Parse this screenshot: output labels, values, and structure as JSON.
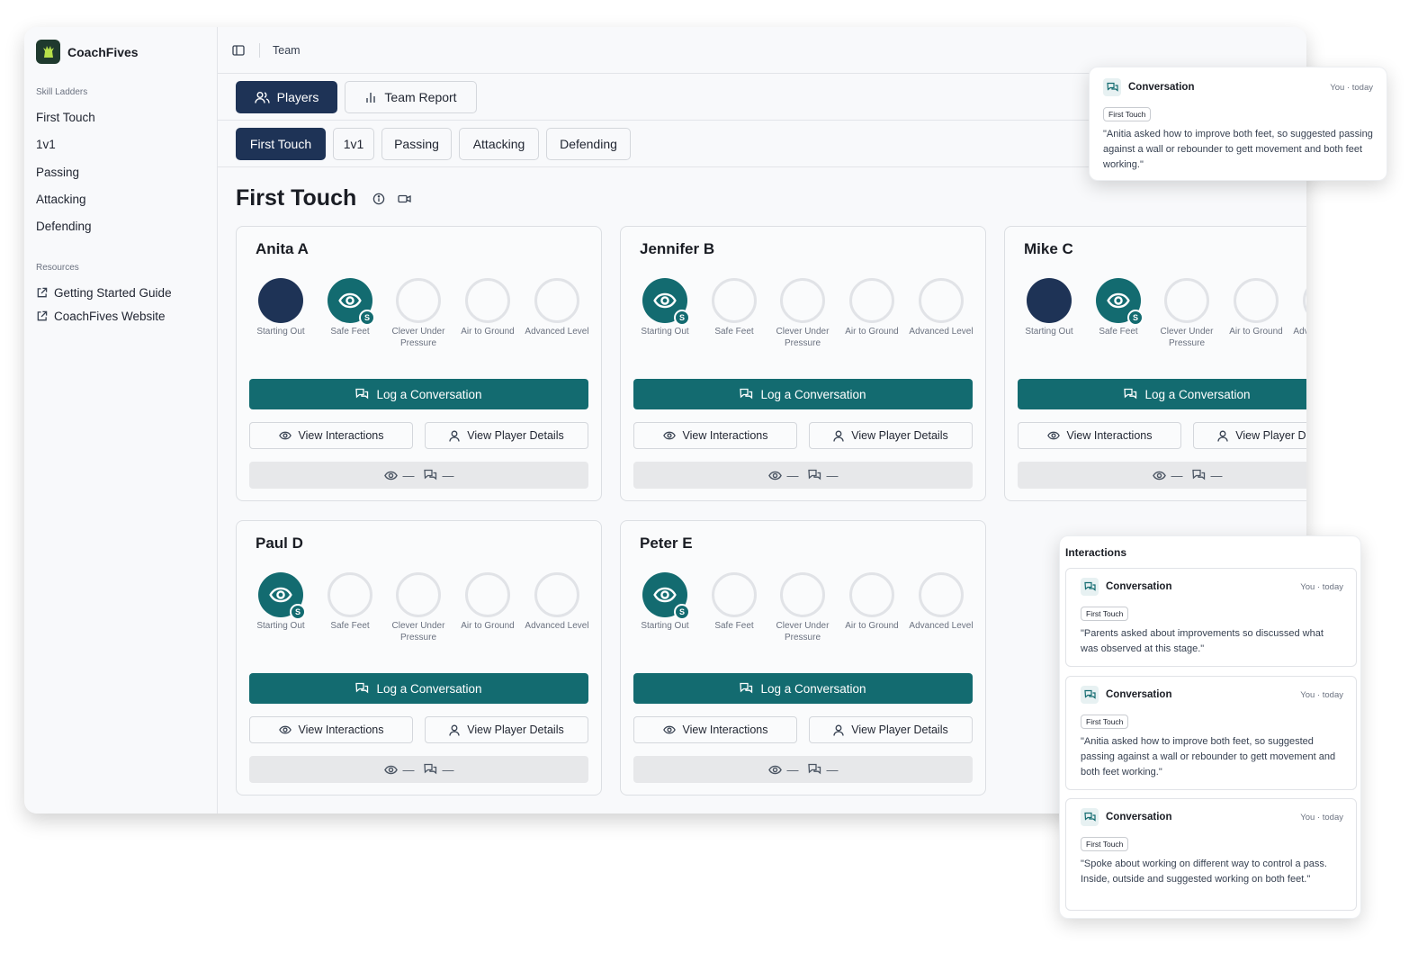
{
  "app": {
    "name": "CoachFives"
  },
  "sidebar": {
    "skill_ladders_label": "Skill Ladders",
    "items": [
      {
        "label": "First Touch"
      },
      {
        "label": "1v1"
      },
      {
        "label": "Passing"
      },
      {
        "label": "Attacking"
      },
      {
        "label": "Defending"
      }
    ],
    "resources_label": "Resources",
    "resources": [
      {
        "label": "Getting Started Guide"
      },
      {
        "label": "CoachFives Website"
      }
    ]
  },
  "topbar": {
    "breadcrumb": "Team"
  },
  "view_tabs": [
    {
      "label": "Players",
      "icon": "users-icon",
      "active": true
    },
    {
      "label": "Team Report",
      "icon": "bar-chart-icon",
      "active": false
    }
  ],
  "skill_tabs": [
    {
      "label": "First Touch",
      "active": true
    },
    {
      "label": "1v1",
      "active": false
    },
    {
      "label": "Passing",
      "active": false
    },
    {
      "label": "Attacking",
      "active": false
    },
    {
      "label": "Defending",
      "active": false
    }
  ],
  "page": {
    "title": "First Touch"
  },
  "levels": [
    {
      "label": "Starting Out"
    },
    {
      "label": "Safe Feet"
    },
    {
      "label": "Clever Under Pressure"
    },
    {
      "label": "Air to Ground"
    },
    {
      "label": "Advanced Level"
    }
  ],
  "players": [
    {
      "name": "Anita A",
      "states": [
        "done",
        "current",
        "empty",
        "empty",
        "empty"
      ]
    },
    {
      "name": "Jennifer B",
      "states": [
        "current",
        "empty",
        "empty",
        "empty",
        "empty"
      ]
    },
    {
      "name": "Mike C",
      "states": [
        "done",
        "current",
        "empty",
        "empty",
        "empty"
      ]
    },
    {
      "name": "Paul D",
      "states": [
        "current",
        "empty",
        "empty",
        "empty",
        "empty"
      ]
    },
    {
      "name": "Peter E",
      "states": [
        "current",
        "empty",
        "empty",
        "empty",
        "empty"
      ]
    }
  ],
  "card_labels": {
    "log": "Log a Conversation",
    "view_interactions": "View Interactions",
    "view_details": "View Player Details",
    "stat_placeholder": "—",
    "current_badge": "S"
  },
  "popup": {
    "title": "Conversation",
    "meta": "You · today",
    "tag": "First Touch",
    "text": "\"Anitia asked how to improve both feet, so suggested passing against a wall or rebounder to gett movement and both feet working.\""
  },
  "interactions": {
    "title": "Interactions",
    "items": [
      {
        "title": "Conversation",
        "meta": "You · today",
        "tag": "First Touch",
        "text": "\"Parents asked about improvements so discussed what was observed at this stage.\""
      },
      {
        "title": "Conversation",
        "meta": "You · today",
        "tag": "First Touch",
        "text": "\"Anitia asked how to improve both feet, so suggested passing against a wall or rebounder to gett movement and both feet working.\""
      },
      {
        "title": "Conversation",
        "meta": "You · today",
        "tag": "First Touch",
        "text": "\"Spoke about working on different way to control a pass. Inside, outside and suggested working on both feet.\""
      }
    ]
  },
  "colors": {
    "navy": "#1e3356",
    "teal": "#136b70",
    "border": "#dcdfe3"
  }
}
